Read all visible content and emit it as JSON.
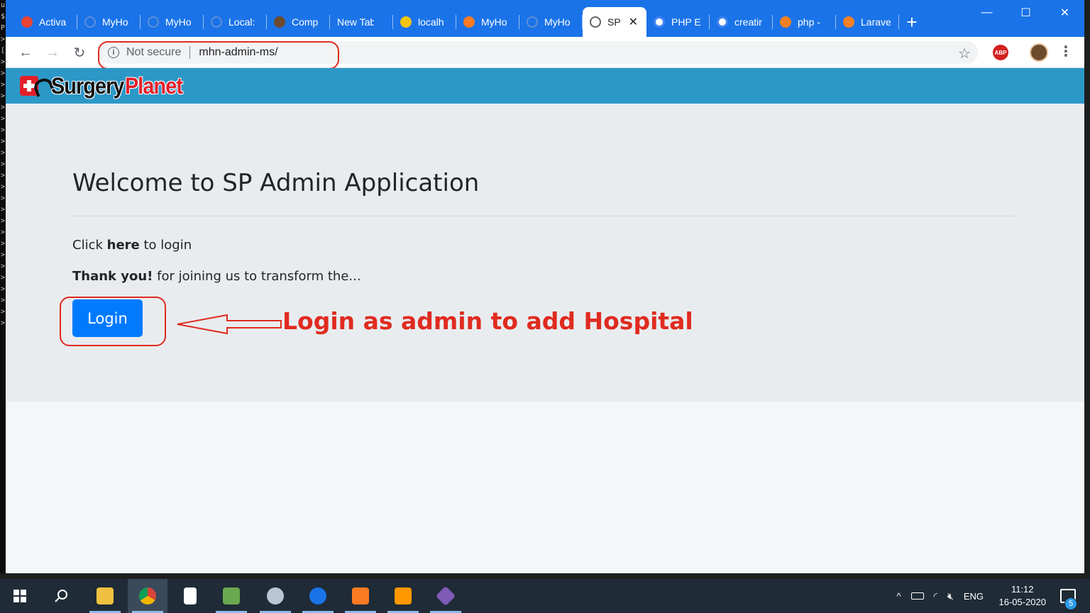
{
  "browser": {
    "tabs": [
      {
        "label": "Activa",
        "icon": "gmail-icon",
        "color": "#ea4335"
      },
      {
        "label": "MyHo",
        "icon": "globe-icon",
        "color": "#5f8fd6"
      },
      {
        "label": "MyHo",
        "icon": "globe-icon",
        "color": "#5f8fd6"
      },
      {
        "label": "Local:",
        "icon": "globe-icon",
        "color": "#5f8fd6"
      },
      {
        "label": "Comp",
        "icon": "composer-icon",
        "color": "#6c4a2e"
      },
      {
        "label": "New Tab",
        "icon": "",
        "color": ""
      },
      {
        "label": "localh",
        "icon": "laravel-icon",
        "color": "#f1c40f"
      },
      {
        "label": "MyHo",
        "icon": "xampp-icon",
        "color": "#fb7a24"
      },
      {
        "label": "MyHo",
        "icon": "globe-icon",
        "color": "#5f8fd6"
      },
      {
        "label": "SP",
        "icon": "globe-icon",
        "color": "#5f6368",
        "active": true,
        "close": "✕"
      },
      {
        "label": "PHP E",
        "icon": "google-icon",
        "color": "#ffffff"
      },
      {
        "label": "creatir",
        "icon": "google-icon",
        "color": "#ffffff"
      },
      {
        "label": "php -",
        "icon": "stackoverflow-icon",
        "color": "#f48024"
      },
      {
        "label": "Larave",
        "icon": "stackoverflow-icon",
        "color": "#f48024"
      }
    ],
    "new_tab_symbol": "+",
    "window_controls": {
      "minimize": "—",
      "maximize": "☐",
      "close": "✕"
    },
    "nav": {
      "back": "←",
      "forward": "→",
      "reload": "↻"
    },
    "omnibox": {
      "info_symbol": "i",
      "security_text": "Not secure",
      "url": "mhn-admin-ms/"
    },
    "bookmark_symbol": "☆",
    "abp_label": "ABP",
    "menu_symbol": "⋮"
  },
  "site": {
    "logo_part1": "Surgery",
    "logo_part2": "Planet",
    "heading": "Welcome to SP Admin Application",
    "line1_pre": "Click ",
    "line1_bold": "here",
    "line1_post": " to login",
    "line2_bold": "Thank you!",
    "line2_post": " for joining us to transform the...",
    "login_label": "Login"
  },
  "annotation": {
    "text": "Login as admin to add Hospital",
    "color": "#e02b20"
  },
  "taskbar": {
    "items": [
      "windows-start-icon",
      "search-icon",
      "file-explorer-icon",
      "chrome-icon",
      "notepad-icon",
      "image-editor-icon",
      "paint-icon",
      "maps-icon",
      "xampp-icon",
      "sublime-icon",
      "git-icon"
    ],
    "language": "ENG",
    "time": "11:12",
    "date": "16-05-2020",
    "notification_count": "5",
    "tray_arrow": "^"
  }
}
